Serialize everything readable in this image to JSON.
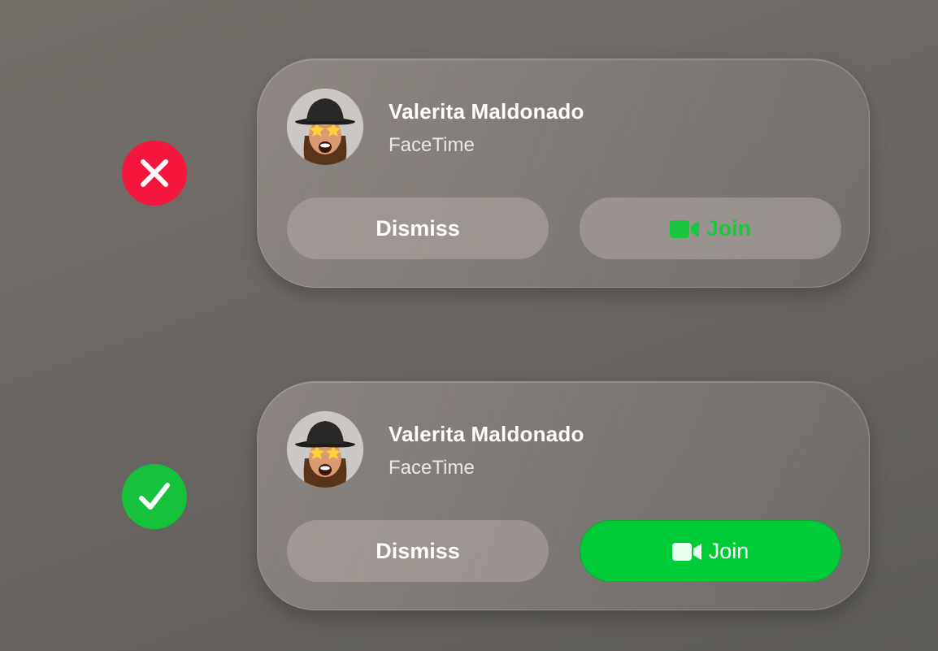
{
  "colors": {
    "bad_mark": "#f5163e",
    "good_mark": "#16c23c",
    "join_green": "#00cc38",
    "join_text_green": "#19c640"
  },
  "markers": {
    "incorrect_icon": "x-mark-icon",
    "correct_icon": "checkmark-icon"
  },
  "cards": [
    {
      "variant": "incorrect",
      "caller_name": "Valerita Maldonado",
      "app_name": "FaceTime",
      "avatar_icon": "memoji-avatar-icon",
      "dismiss_label": "Dismiss",
      "join_label": "Join",
      "join_icon": "video-camera-icon"
    },
    {
      "variant": "correct",
      "caller_name": "Valerita Maldonado",
      "app_name": "FaceTime",
      "avatar_icon": "memoji-avatar-icon",
      "dismiss_label": "Dismiss",
      "join_label": "Join",
      "join_icon": "video-camera-icon"
    }
  ]
}
